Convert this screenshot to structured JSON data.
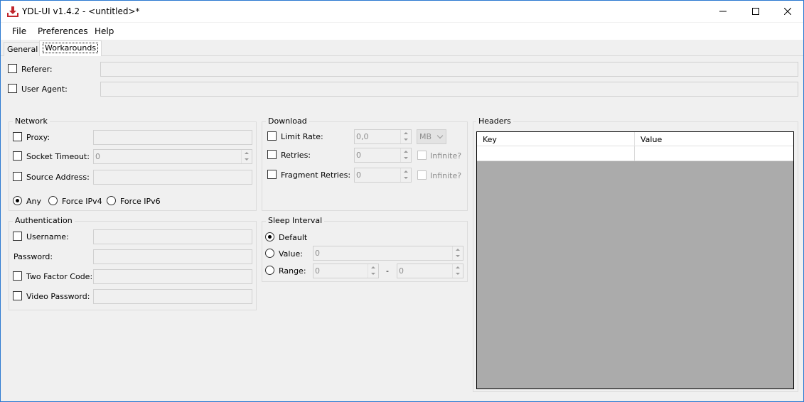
{
  "window": {
    "title": "YDL-UI v1.4.2 - <untitled>*",
    "icon": "download-icon",
    "controls": [
      "minimize-icon",
      "maximize-icon",
      "close-icon"
    ]
  },
  "menu": {
    "file": "File",
    "preferences": "Preferences",
    "help": "Help"
  },
  "tabs": {
    "general": "General",
    "workarounds": "Workarounds",
    "active": "Workarounds"
  },
  "top": {
    "referer_label": "Referer:",
    "referer_value": "",
    "user_agent_label": "User Agent:",
    "user_agent_value": ""
  },
  "network": {
    "title": "Network",
    "proxy_label": "Proxy:",
    "proxy_value": "",
    "socket_timeout_label": "Socket Timeout:",
    "socket_timeout_value": "0",
    "source_address_label": "Source Address:",
    "source_address_value": "",
    "ip_any": "Any",
    "ip_force4": "Force IPv4",
    "ip_force6": "Force IPv6",
    "ip_selected": "Any"
  },
  "authentication": {
    "title": "Authentication",
    "username_label": "Username:",
    "username_value": "",
    "password_label": "Password:",
    "password_value": "",
    "two_factor_label": "Two Factor Code:",
    "two_factor_value": "",
    "video_password_label": "Video Password:",
    "video_password_value": ""
  },
  "download": {
    "title": "Download",
    "limit_rate_label": "Limit Rate:",
    "limit_rate_value": "0,0",
    "limit_rate_unit": "MB",
    "retries_label": "Retries:",
    "retries_value": "0",
    "retries_infinite": "Infinite?",
    "fragment_retries_label": "Fragment Retries:",
    "fragment_retries_value": "0",
    "fragment_infinite": "Infinite?"
  },
  "sleep": {
    "title": "Sleep Interval",
    "default_label": "Default",
    "value_label": "Value:",
    "value_value": "0",
    "range_label": "Range:",
    "range_from": "0",
    "range_sep": "-",
    "range_to": "0",
    "selected": "Default"
  },
  "headers": {
    "title": "Headers",
    "col_key": "Key",
    "col_value": "Value",
    "rows": [
      {
        "key": "",
        "value": ""
      }
    ]
  },
  "colors": {
    "accent": "#2b79d0",
    "table_empty": "#ababab",
    "icon_red": "#c0262c"
  }
}
